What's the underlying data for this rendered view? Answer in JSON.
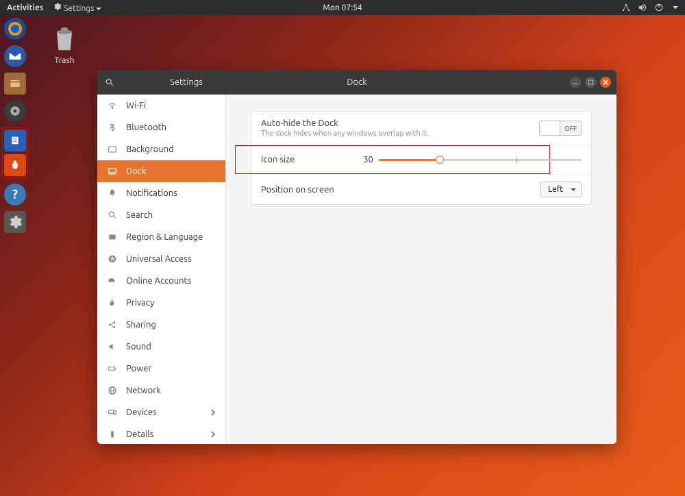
{
  "top_panel": {
    "activities": "Activities",
    "app_title": "Settings",
    "clock": "Mon 07:54"
  },
  "desktop": {
    "trash_label": "Trash"
  },
  "window": {
    "sidebar_title": "Settings",
    "header_title": "Dock"
  },
  "sidebar": {
    "items": [
      {
        "label": "Wi-Fi"
      },
      {
        "label": "Bluetooth"
      },
      {
        "label": "Background"
      },
      {
        "label": "Dock"
      },
      {
        "label": "Notifications"
      },
      {
        "label": "Search"
      },
      {
        "label": "Region & Language"
      },
      {
        "label": "Universal Access"
      },
      {
        "label": "Online Accounts"
      },
      {
        "label": "Privacy"
      },
      {
        "label": "Sharing"
      },
      {
        "label": "Sound"
      },
      {
        "label": "Power"
      },
      {
        "label": "Network"
      },
      {
        "label": "Devices"
      },
      {
        "label": "Details"
      }
    ]
  },
  "dock_settings": {
    "autohide_title": "Auto-hide the Dock",
    "autohide_sub": "The dock hides when any windows overlap with it.",
    "autohide_state": "OFF",
    "icon_size_label": "Icon size",
    "icon_size_value": "30",
    "position_label": "Position on screen",
    "position_value": "Left"
  }
}
